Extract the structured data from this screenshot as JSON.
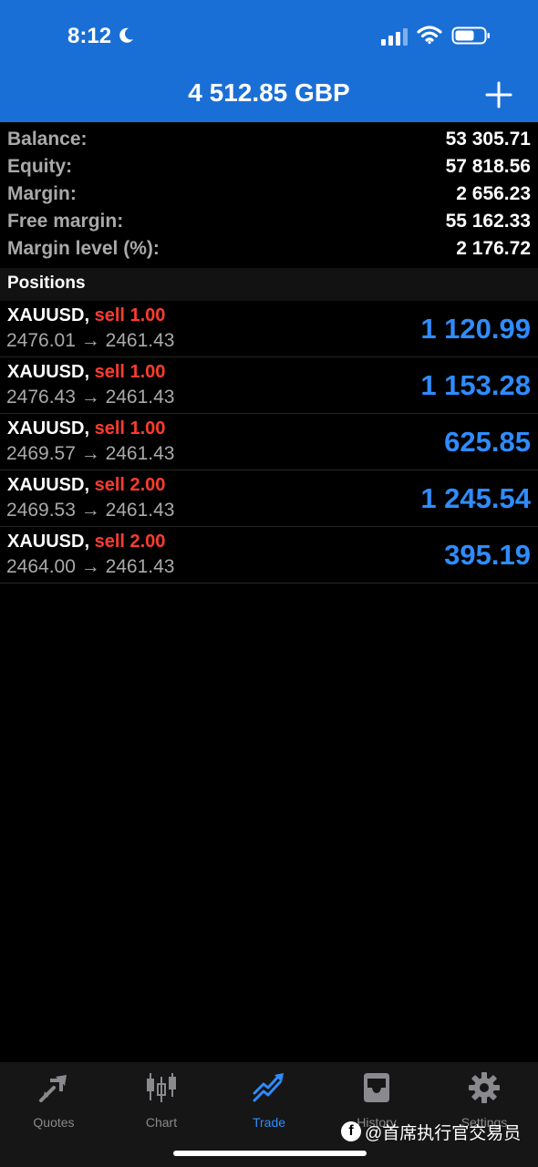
{
  "status_bar": {
    "time": "8:12"
  },
  "header": {
    "title": "4 512.85 GBP"
  },
  "summary": [
    {
      "label": "Balance:",
      "value": "53 305.71"
    },
    {
      "label": "Equity:",
      "value": "57 818.56"
    },
    {
      "label": "Margin:",
      "value": "2 656.23"
    },
    {
      "label": "Free margin:",
      "value": "55 162.33"
    },
    {
      "label": "Margin level (%):",
      "value": "2 176.72"
    }
  ],
  "positions_header": "Positions",
  "positions": [
    {
      "symbol": "XAUUSD,",
      "type": "sell 1.00",
      "prices": "2476.01 → 2461.43",
      "profit": "1 120.99"
    },
    {
      "symbol": "XAUUSD,",
      "type": "sell 1.00",
      "prices": "2476.43 → 2461.43",
      "profit": "1 153.28"
    },
    {
      "symbol": "XAUUSD,",
      "type": "sell 1.00",
      "prices": "2469.57 → 2461.43",
      "profit": "625.85"
    },
    {
      "symbol": "XAUUSD,",
      "type": "sell 2.00",
      "prices": "2469.53 → 2461.43",
      "profit": "1 245.54"
    },
    {
      "symbol": "XAUUSD,",
      "type": "sell 2.00",
      "prices": "2464.00 → 2461.43",
      "profit": "395.19"
    }
  ],
  "tabs": [
    {
      "label": "Quotes",
      "icon": "quotes-icon"
    },
    {
      "label": "Chart",
      "icon": "chart-icon"
    },
    {
      "label": "Trade",
      "icon": "trade-icon",
      "active": true
    },
    {
      "label": "History",
      "icon": "history-icon"
    },
    {
      "label": "Settings",
      "icon": "settings-icon"
    }
  ],
  "watermark": "@首席执行官交易员",
  "colors": {
    "header": "#1a6fd6",
    "sell": "#ff3b30",
    "profit": "#2f8cff",
    "muted": "#a9a9ab"
  }
}
